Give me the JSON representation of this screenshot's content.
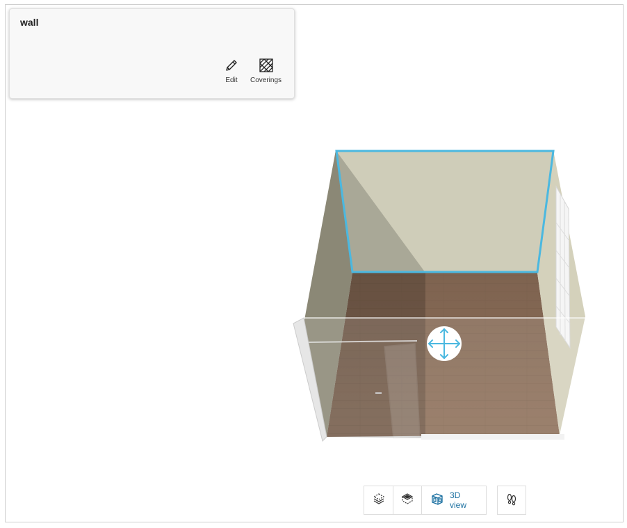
{
  "selection_panel": {
    "title": "wall",
    "actions": [
      {
        "label": "Edit",
        "icon": "pencil-icon"
      },
      {
        "label": "Coverings",
        "icon": "coverings-icon"
      }
    ]
  },
  "view_toolbar": {
    "buttons": [
      {
        "icon": "2d-plan-icon",
        "label": ""
      },
      {
        "icon": "3d-top-icon",
        "label": ""
      },
      {
        "icon": "3d-view-icon",
        "label": "3D view",
        "active": true
      }
    ],
    "walk_icon": "footsteps-icon"
  },
  "colors": {
    "selection_outline": "#4bb8e0",
    "active_view": "#1a6fa0",
    "wall_back": "#cfcdb9",
    "wall_side": "#b9b6a0",
    "floor": "#8a6a52"
  }
}
